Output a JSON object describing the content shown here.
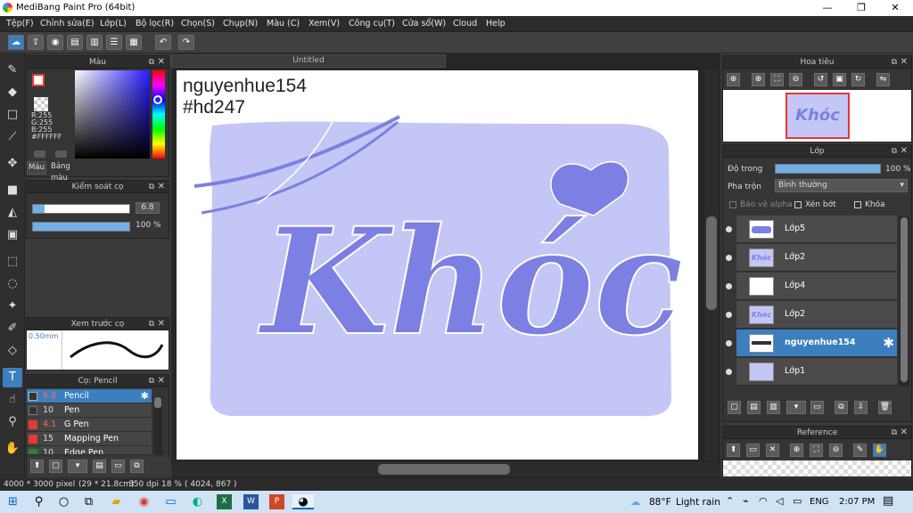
{
  "window": {
    "title": "MediBang Paint Pro (64bit)",
    "minimize": "—",
    "maximize": "❐",
    "close": "✕"
  },
  "menu": [
    "Tệp(F)",
    "Chỉnh sửa(E)",
    "Lớp(L)",
    "Bộ lọc(R)",
    "Chọn(S)",
    "Chụp(N)",
    "Màu (C)",
    "Xem(V)",
    "Công cụ(T)",
    "Cửa sổ(W)",
    "Cloud",
    "Help"
  ],
  "color_panel": {
    "title": "Màu",
    "r": "R:255",
    "g": "G:255",
    "b": "B:255",
    "hex": "#FFFFFF",
    "tab_color": "Màu",
    "tab_palette": "Bảng màu"
  },
  "brush_control": {
    "title": "Kiểm soát cọ",
    "size": "6.8",
    "opacity": "100 %"
  },
  "brush_preview": {
    "title": "Xem trước cọ",
    "size": "0.50mm"
  },
  "brush_list": {
    "title": "Cọ: Pencil",
    "items": [
      {
        "size": "6.8",
        "name": "Pencil",
        "color": "#333333"
      },
      {
        "size": "10",
        "name": "Pen",
        "color": "#333333"
      },
      {
        "size": "4.1",
        "name": "G Pen",
        "color": "#e53935"
      },
      {
        "size": "15",
        "name": "Mapping Pen",
        "color": "#e53935"
      },
      {
        "size": "10",
        "name": "Edge Pen",
        "color": "#2e7d32"
      }
    ]
  },
  "document": {
    "tab": "Untitled",
    "line1": "nguyenhue154",
    "line2": "#hd247",
    "artwork_text": "Khóc"
  },
  "navigator": {
    "title": "Hoa tiêu"
  },
  "layer_panel": {
    "title": "Lớp",
    "opacity_label": "Độ trong",
    "opacity_value": "100 %",
    "blend_label": "Pha trộn",
    "blend_value": "Bình thường",
    "protect_alpha": "Bảo vệ alpha",
    "clipping": "Xén bớt",
    "lock": "Khóa",
    "layers": [
      {
        "name": "Lớp5",
        "selected": false
      },
      {
        "name": "Lớp2",
        "selected": false
      },
      {
        "name": "Lớp4",
        "selected": false
      },
      {
        "name": "Lớp2",
        "selected": false
      },
      {
        "name": "nguyenhue154",
        "selected": true
      },
      {
        "name": "Lớp1",
        "selected": false
      }
    ]
  },
  "reference": {
    "title": "Reference"
  },
  "status": {
    "size": "4000 * 3000 pixel",
    "cm": "(29 * 21.8cm)",
    "dpi": "350 dpi",
    "zoom": "18 %",
    "coords": "( 4024, 867 )"
  },
  "taskbar": {
    "weather_temp": "88°F",
    "weather_desc": "Light rain",
    "lang": "ENG",
    "time": "2:07 PM"
  },
  "colors": {
    "accent": "#3c7fbf",
    "lavender": "#c4c6f5",
    "letter": "#7b80e2"
  }
}
